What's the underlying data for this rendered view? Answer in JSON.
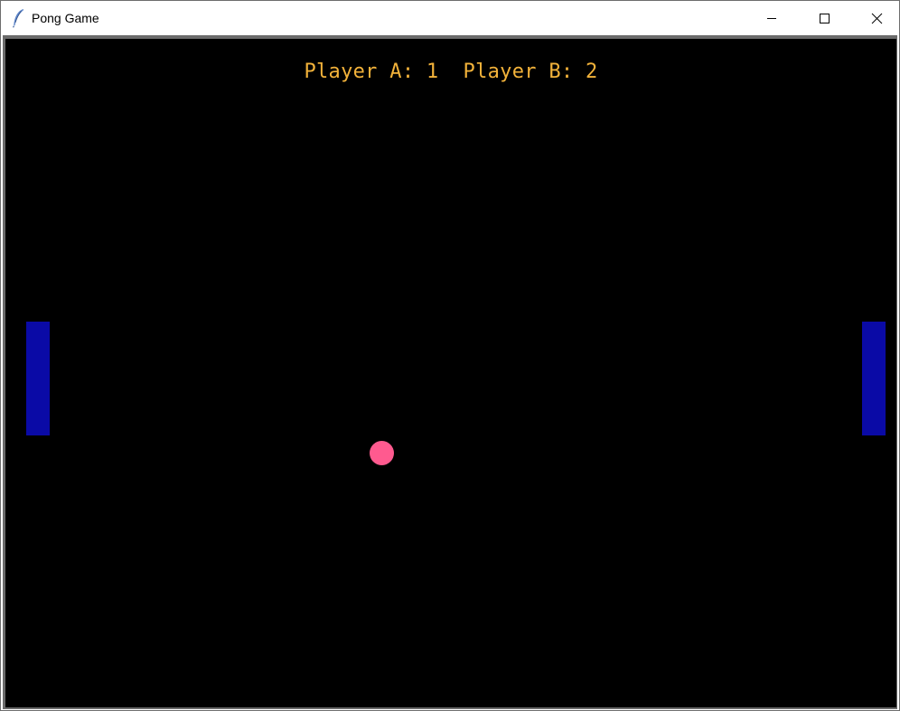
{
  "window": {
    "title": "Pong Game",
    "icon": "feather-icon",
    "controls": {
      "minimize_icon": "minimize-icon",
      "maximize_icon": "maximize-icon",
      "close_icon": "close-icon"
    }
  },
  "game": {
    "scoreboard": {
      "text": "Player A: 1  Player B: 2",
      "player_a_label": "Player A",
      "player_a_score": 1,
      "player_b_label": "Player B",
      "player_b_score": 2
    },
    "colors": {
      "background": "#000000",
      "score_text": "#f2b23a",
      "paddle": "#0a0aa6",
      "ball": "#ff5a8f",
      "border": "#6b6b6b"
    },
    "objects": {
      "paddle_a": "paddle-a",
      "paddle_b": "paddle-b",
      "ball": "ball"
    }
  }
}
